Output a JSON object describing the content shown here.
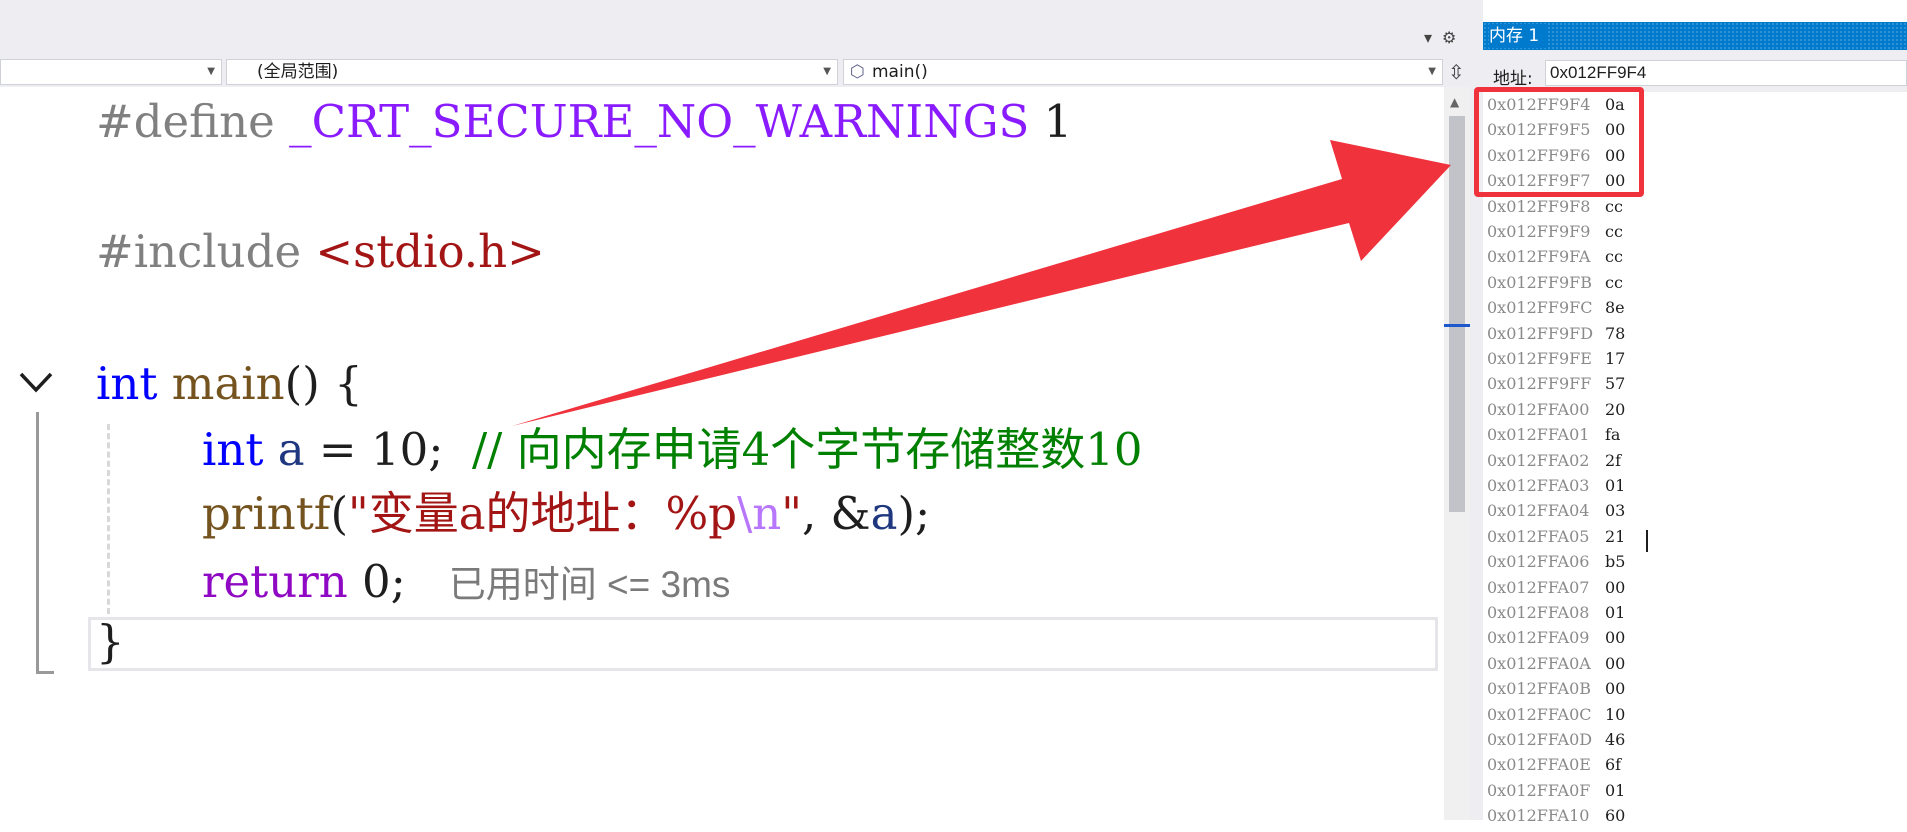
{
  "nav": {
    "scope": "(全局范围)",
    "function": "main()"
  },
  "code": {
    "l1": {
      "directive": "#define",
      "macro": "_CRT_SECURE_NO_WARNINGS",
      "value": "1"
    },
    "l2": {
      "directive": "#include",
      "header": "<stdio.h>"
    },
    "l3": {
      "type": "int",
      "name": "main",
      "rest": "() {"
    },
    "l4": {
      "type": "int",
      "var": "a",
      "rest": " = 10;  ",
      "comment": "// 向内存申请4个字节存储整数10"
    },
    "l5": {
      "fn": "printf",
      "paren": "(",
      "str": "\"变量a的地址：%p",
      "esc": "\\n",
      "strend": "\"",
      "comma": ", &",
      "var": "a",
      "end": ");"
    },
    "l6": {
      "kw": "return",
      "rest": " 0;",
      "hint": "已用时间 <= 3ms"
    },
    "l7": {
      "brace": "}"
    }
  },
  "memory": {
    "title": "内存 1",
    "address_label": "地址:",
    "address_value": "0x012FF9F4",
    "rows": [
      {
        "addr": "0x012FF9F4",
        "val": "0a"
      },
      {
        "addr": "0x012FF9F5",
        "val": "00"
      },
      {
        "addr": "0x012FF9F6",
        "val": "00"
      },
      {
        "addr": "0x012FF9F7",
        "val": "00"
      },
      {
        "addr": "0x012FF9F8",
        "val": "cc"
      },
      {
        "addr": "0x012FF9F9",
        "val": "cc"
      },
      {
        "addr": "0x012FF9FA",
        "val": "cc"
      },
      {
        "addr": "0x012FF9FB",
        "val": "cc"
      },
      {
        "addr": "0x012FF9FC",
        "val": "8e"
      },
      {
        "addr": "0x012FF9FD",
        "val": "78"
      },
      {
        "addr": "0x012FF9FE",
        "val": "17"
      },
      {
        "addr": "0x012FF9FF",
        "val": "57"
      },
      {
        "addr": "0x012FFA00",
        "val": "20"
      },
      {
        "addr": "0x012FFA01",
        "val": "fa"
      },
      {
        "addr": "0x012FFA02",
        "val": "2f"
      },
      {
        "addr": "0x012FFA03",
        "val": "01"
      },
      {
        "addr": "0x012FFA04",
        "val": "03"
      },
      {
        "addr": "0x012FFA05",
        "val": "21"
      },
      {
        "addr": "0x012FFA06",
        "val": "b5"
      },
      {
        "addr": "0x012FFA07",
        "val": "00"
      },
      {
        "addr": "0x012FFA08",
        "val": "01"
      },
      {
        "addr": "0x012FFA09",
        "val": "00"
      },
      {
        "addr": "0x012FFA0A",
        "val": "00"
      },
      {
        "addr": "0x012FFA0B",
        "val": "00"
      },
      {
        "addr": "0x012FFA0C",
        "val": "10"
      },
      {
        "addr": "0x012FFA0D",
        "val": "46"
      },
      {
        "addr": "0x012FFA0E",
        "val": "6f"
      },
      {
        "addr": "0x012FFA0F",
        "val": "01"
      },
      {
        "addr": "0x012FFA10",
        "val": "60"
      }
    ]
  },
  "colors": {
    "annotation_red": "#f0323c",
    "title_blue": "#007acc"
  }
}
